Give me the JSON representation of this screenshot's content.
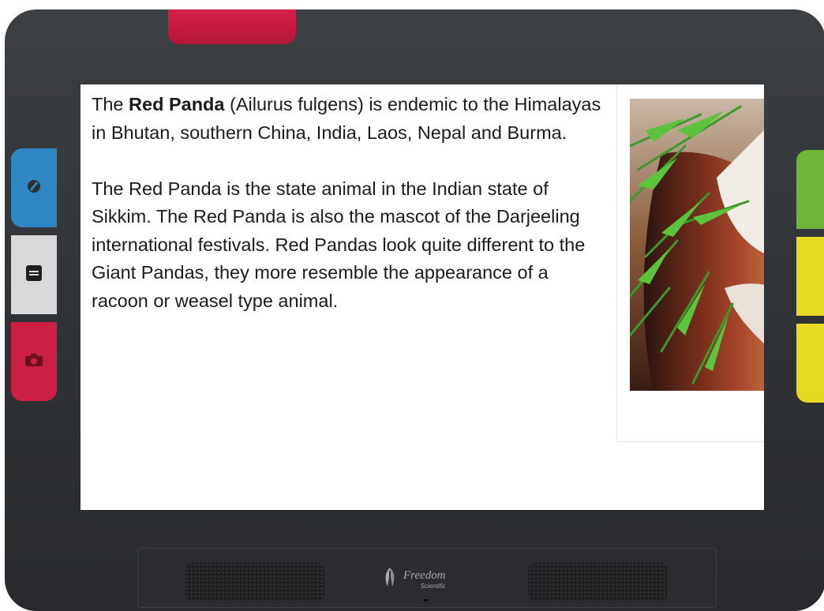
{
  "device": {
    "buttons": {
      "left": [
        "contrast-icon",
        "menu-icon",
        "camera-icon"
      ],
      "right": [
        "home-icon",
        "plus-icon",
        "minus-icon"
      ],
      "plus_symbol": "+",
      "minus_symbol": "−"
    },
    "colors": {
      "body": "#2f3235",
      "power": "#cc1f45",
      "contrast": "#2f86c4",
      "menu": "#d9d9d9",
      "camera": "#cc1f45",
      "home": "#72b43b",
      "zoom": "#e6db22"
    }
  },
  "screen": {
    "article": {
      "p1": {
        "lead": "The ",
        "bold": "Red Panda",
        "rest": " (Ailurus fulgens) is endemic to the Himalayas in Bhutan, southern China, India, Laos, Nepal and Burma."
      },
      "p2": "The Red Panda is the state animal in the Indian state of Sikkim. The Red Panda is also the mascot of the Darjeeling international festivals. Red Pandas look quite different to the Giant Pandas, they more resemble the appearance of a racoon or weasel type animal."
    }
  },
  "branding": {
    "name": "Freedom",
    "sub": "Scientific"
  }
}
